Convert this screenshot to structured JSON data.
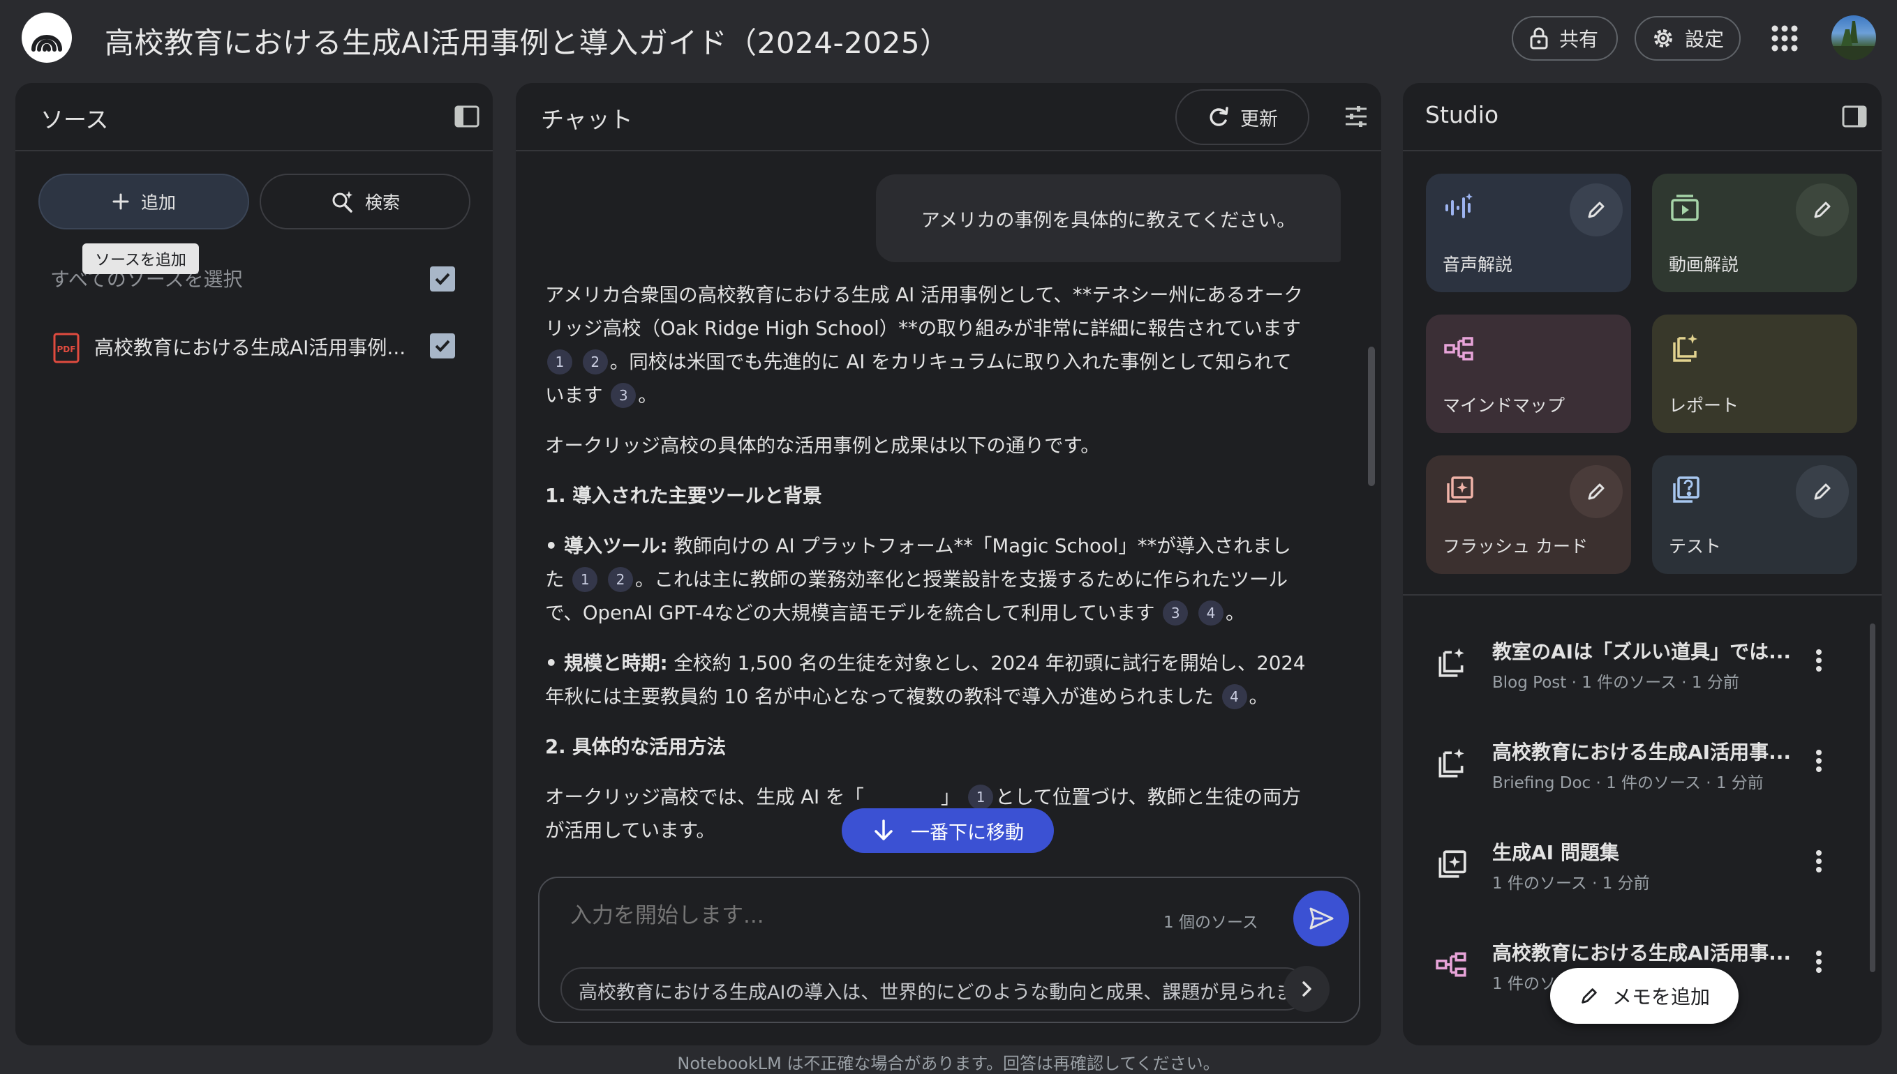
{
  "header": {
    "title": "高校教育における生成AI活用事例と導入ガイド（2024-2025）",
    "share_label": "共有",
    "settings_label": "設定"
  },
  "sources": {
    "title": "ソース",
    "add_label": "追加",
    "search_label": "検索",
    "tooltip": "ソースを追加",
    "select_all": "すべてのソースを選択",
    "items": [
      {
        "icon": "pdf-icon",
        "label": "高校教育における生成AI活用事例...",
        "checked": true
      }
    ]
  },
  "chat": {
    "title": "チャット",
    "refresh_label": "更新",
    "user_message": "アメリカの事例を具体的に教えてください。",
    "answer": {
      "p1_a": "アメリカ合衆国の高校教育における生成 AI 活用事例として、**テネシー州にあるオークリッジ高校（Oak Ridge High School）**の取り組みが非常に詳細に報告されています",
      "p1_b": "。同校は米国でも先進的に AI をカリキュラムに取り入れた事例として知られています",
      "p1_c": "。",
      "p2": "オークリッジ高校の具体的な活用事例と成果は以下の通りです。",
      "h1": "1. 導入された主要ツールと背景",
      "b1_label": "• 導入ツール:",
      "b1_a": " 教師向けの AI プラットフォーム**「Magic School」**が導入されました",
      "b1_b": "。これは主に教師の業務効率化と授業設計を支援するために作られたツールで、OpenAI GPT-4などの大規模言語モデルを統合して利用しています",
      "b1_c": "。",
      "b2_label": "• 規模と時期:",
      "b2_a": " 全校約 1,500 名の生徒を対象とし、2024 年初頭に試行を開始し、2024 年秋には主要教員約 10 名が中心となって複数の教科で導入が進められました",
      "b2_b": "。",
      "h2": "2. 具体的な活用方法",
      "p3_a": "オークリッジ高校では、生成 AI を「",
      "p3_b": "」",
      "p3_c": "として位置づけ、教師と生徒の両方が活用しています。"
    },
    "citations": [
      "1",
      "2",
      "3",
      "4"
    ],
    "jump_label": "一番下に移動",
    "input_placeholder": "入力を開始します...",
    "source_count": "1 個のソース",
    "suggestion": "高校教育における生成AIの導入は、世界的にどのような動向と成果、課題が見られますか？"
  },
  "studio": {
    "title": "Studio",
    "tiles": [
      {
        "label": "音声解説",
        "icon": "audio-waveform-icon"
      },
      {
        "label": "動画解説",
        "icon": "video-icon"
      },
      {
        "label": "マインドマップ",
        "icon": "mindmap-icon"
      },
      {
        "label": "レポート",
        "icon": "report-icon"
      },
      {
        "label": "フラッシュ カード",
        "icon": "flashcard-icon"
      },
      {
        "label": "テスト",
        "icon": "quiz-icon"
      }
    ],
    "notes": [
      {
        "title": "教室のAIは「ズルい道具」では...",
        "meta": "Blog Post · 1 件のソース · 1 分前",
        "icon": "report-icon"
      },
      {
        "title": "高校教育における生成AI活用事...",
        "meta": "Briefing Doc · 1 件のソース · 1 分前",
        "icon": "report-icon"
      },
      {
        "title": "生成AI 問題集",
        "meta": "1 件のソース · 1 分前",
        "icon": "flashcard-icon"
      },
      {
        "title": "高校教育における生成AI活用事...",
        "meta": "1 件のソ",
        "icon": "mindmap-icon"
      }
    ],
    "memo_label": "メモを追加"
  },
  "footer": {
    "disclaimer": "NotebookLM は不正確な場合があります。回答は再確認してください。"
  },
  "colors": {
    "background": "#2a2b2f",
    "panel": "#1e1f22",
    "accent": "#3b51d3"
  }
}
